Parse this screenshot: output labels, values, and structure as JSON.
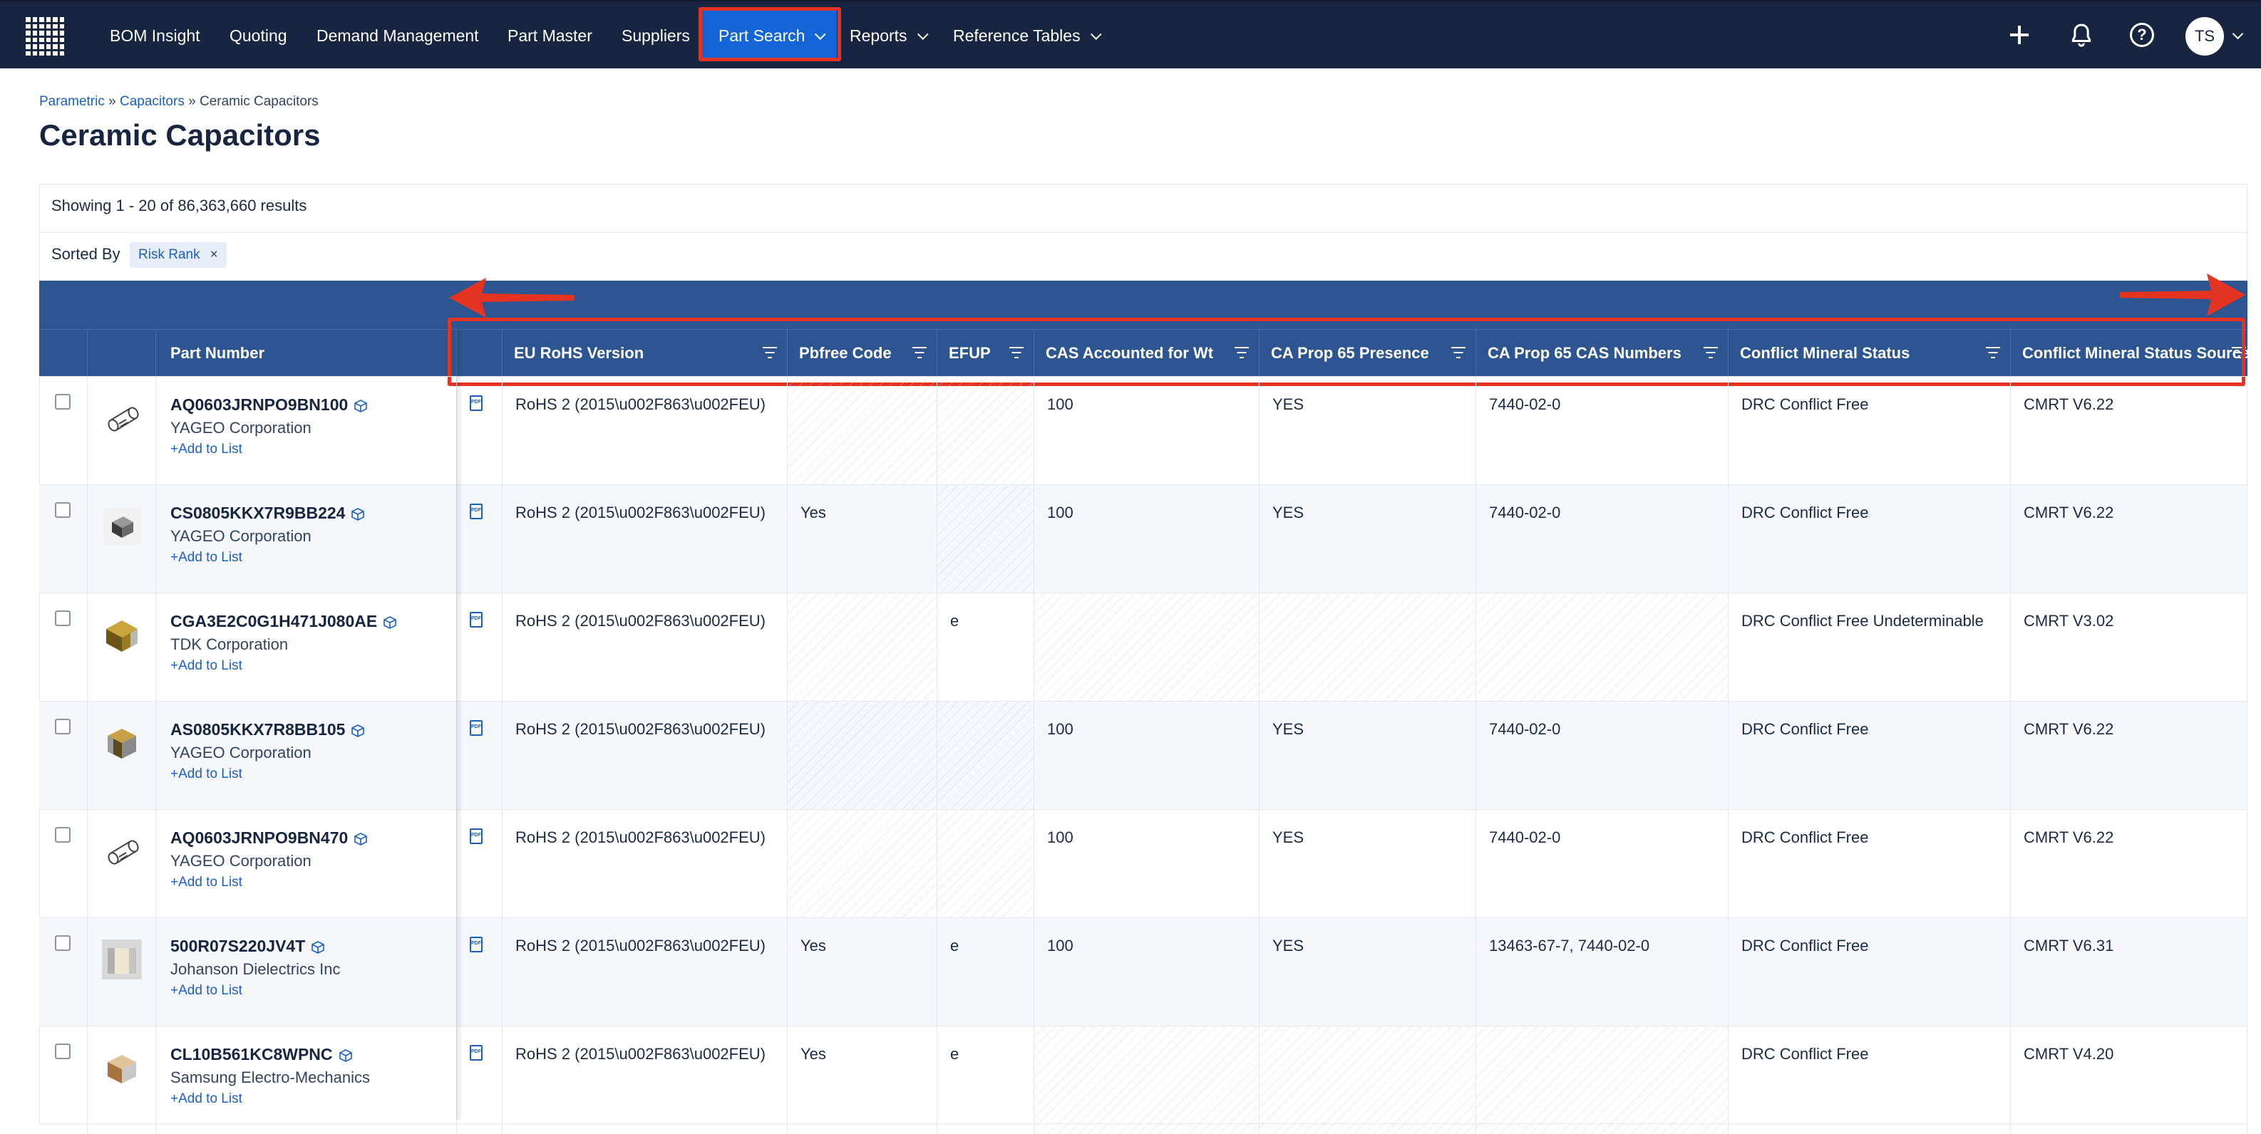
{
  "nav": {
    "items": [
      {
        "label": "BOM Insight"
      },
      {
        "label": "Quoting"
      },
      {
        "label": "Demand Management"
      },
      {
        "label": "Part Master"
      },
      {
        "label": "Suppliers"
      },
      {
        "label": "Part Search",
        "active": true,
        "dropdown": true
      },
      {
        "label": "Reports",
        "dropdown": true
      },
      {
        "label": "Reference Tables",
        "dropdown": true
      }
    ],
    "help_glyph": "?",
    "user_initials": "TS",
    "icons": [
      "grid-logo-icon",
      "plus-icon",
      "bell-icon",
      "help-icon",
      "chevron-down-icon"
    ]
  },
  "breadcrumb": {
    "items": [
      "Parametric",
      "Capacitors",
      "Ceramic Capacitors"
    ],
    "separator": "»"
  },
  "page_title": "Ceramic Capacitors",
  "results": {
    "showing": "Showing 1 - 20 of 86,363,660 results"
  },
  "sort": {
    "label": "Sorted By",
    "chip": "Risk Rank",
    "chip_remove": "×"
  },
  "table": {
    "columns": [
      "Part Number",
      "EU RoHS Version",
      "Pbfree Code",
      "EFUP",
      "CAS Accounted for Wt",
      "CA Prop 65 Presence",
      "CA Prop 65 CAS Numbers",
      "Conflict Mineral Status",
      "Conflict Mineral Status Source"
    ],
    "add_to_list": "+Add to List",
    "rows": [
      {
        "part": "AQ0603JRNPO9BN100",
        "mfr": "YAGEO Corporation",
        "rohs": "RoHS 2 (2015\\u002F863\\u002FEU)",
        "pbfree": "",
        "efup": "",
        "cas_wt": "100",
        "prop65": "YES",
        "prop65_cas": "7440-02-0",
        "cm_status": "DRC Conflict Free",
        "cm_source": "CMRT V6.22"
      },
      {
        "part": "CS0805KKX7R9BB224",
        "mfr": "YAGEO Corporation",
        "rohs": "RoHS 2 (2015\\u002F863\\u002FEU)",
        "pbfree": "Yes",
        "efup": "",
        "cas_wt": "100",
        "prop65": "YES",
        "prop65_cas": "7440-02-0",
        "cm_status": "DRC Conflict Free",
        "cm_source": "CMRT V6.22"
      },
      {
        "part": "CGA3E2C0G1H471J080AE",
        "mfr": "TDK Corporation",
        "rohs": "RoHS 2 (2015\\u002F863\\u002FEU)",
        "pbfree": "",
        "efup": "e",
        "cas_wt": "",
        "prop65": "",
        "prop65_cas": "",
        "cm_status": "DRC Conflict Free Undeterminable",
        "cm_source": "CMRT V3.02"
      },
      {
        "part": "AS0805KKX7R8BB105",
        "mfr": "YAGEO Corporation",
        "rohs": "RoHS 2 (2015\\u002F863\\u002FEU)",
        "pbfree": "",
        "efup": "",
        "cas_wt": "100",
        "prop65": "YES",
        "prop65_cas": "7440-02-0",
        "cm_status": "DRC Conflict Free",
        "cm_source": "CMRT V6.22"
      },
      {
        "part": "AQ0603JRNPO9BN470",
        "mfr": "YAGEO Corporation",
        "rohs": "RoHS 2 (2015\\u002F863\\u002FEU)",
        "pbfree": "",
        "efup": "",
        "cas_wt": "100",
        "prop65": "YES",
        "prop65_cas": "7440-02-0",
        "cm_status": "DRC Conflict Free",
        "cm_source": "CMRT V6.22"
      },
      {
        "part": "500R07S220JV4T",
        "mfr": "Johanson Dielectrics Inc",
        "rohs": "RoHS 2 (2015\\u002F863\\u002FEU)",
        "pbfree": "Yes",
        "efup": "e",
        "cas_wt": "100",
        "prop65": "YES",
        "prop65_cas": "13463-67-7, 7440-02-0",
        "cm_status": "DRC Conflict Free",
        "cm_source": "CMRT V6.31"
      },
      {
        "part": "CL10B561KC8WPNC",
        "mfr": "Samsung Electro-Mechanics",
        "rohs": "RoHS 2 (2015\\u002F863\\u002FEU)",
        "pbfree": "Yes",
        "efup": "e",
        "cas_wt": "",
        "prop65": "",
        "prop65_cas": "",
        "cm_status": "DRC Conflict Free",
        "cm_source": "CMRT V4.20"
      }
    ]
  },
  "colors": {
    "nav_bg": "#182540",
    "active_tab": "#1466d8",
    "table_header": "#2d5591",
    "link": "#1a5fc4",
    "annotation": "#e53322"
  }
}
